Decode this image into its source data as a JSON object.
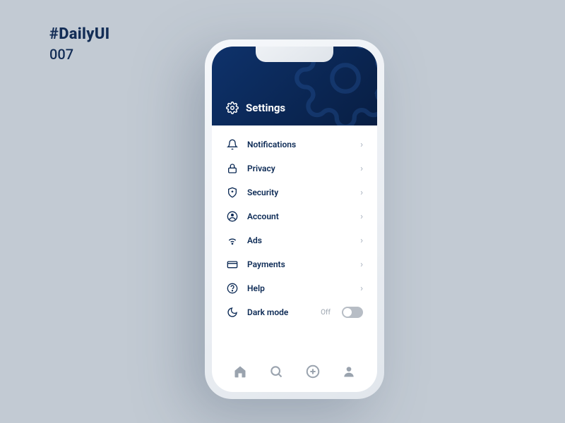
{
  "tagline": {
    "hash": "#DailyUI",
    "num": "007"
  },
  "header": {
    "title": "Settings"
  },
  "settings": {
    "items": [
      {
        "label": "Notifications"
      },
      {
        "label": "Privacy"
      },
      {
        "label": "Security"
      },
      {
        "label": "Account"
      },
      {
        "label": "Ads"
      },
      {
        "label": "Payments"
      },
      {
        "label": "Help"
      }
    ],
    "dark_mode": {
      "label": "Dark mode",
      "state": "Off"
    }
  },
  "nav": {
    "home": "home",
    "search": "search",
    "add": "add",
    "profile": "profile"
  }
}
